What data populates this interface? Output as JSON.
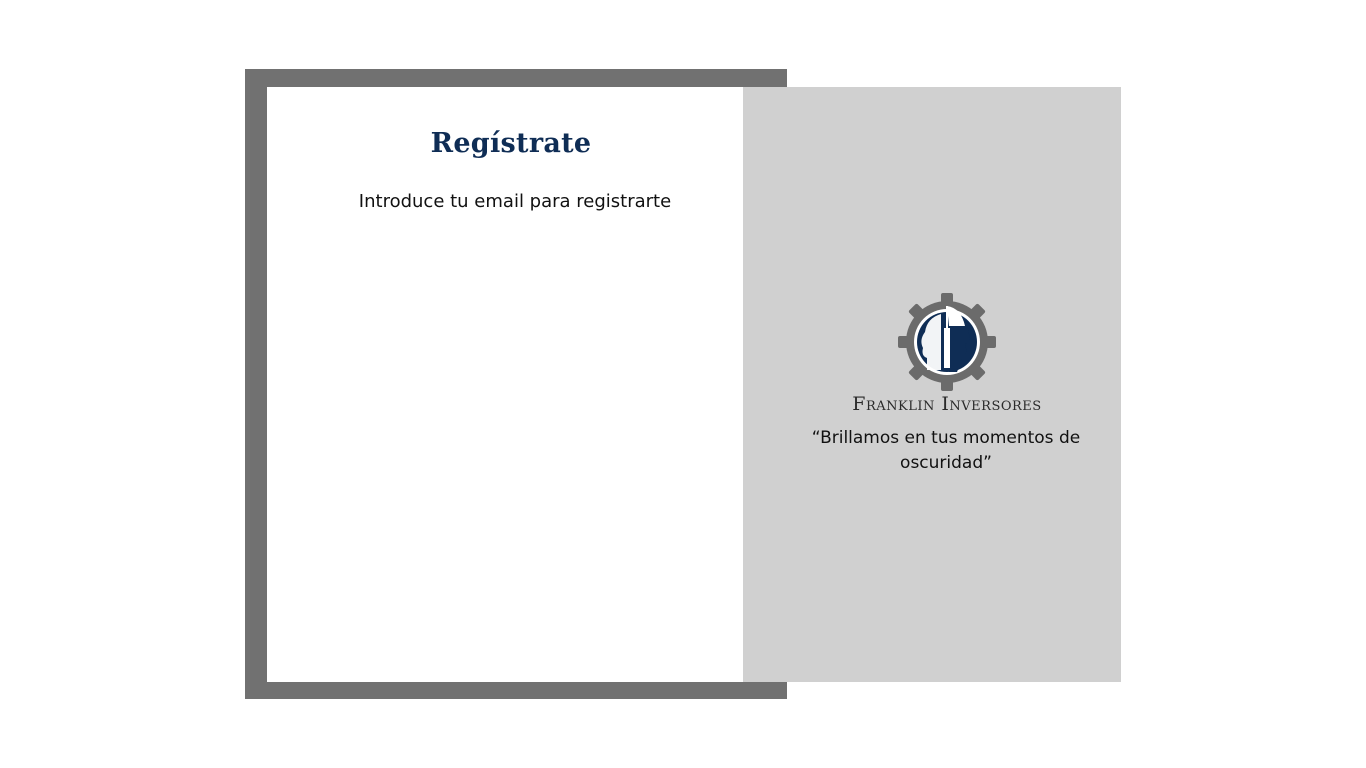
{
  "form": {
    "title": "Regístrate",
    "subtitle": "Introduce tu email para registrarte"
  },
  "brand": {
    "name": "Franklin Inversores",
    "slogan": "“Brillamos en tus momentos de oscuridad”",
    "logo_icon": "gear-head-helmet-icon"
  },
  "colors": {
    "frame": "#717171",
    "brand_panel": "#d0d0d0",
    "title": "#0f2d55",
    "logo_gear": "#6b6b6b",
    "logo_head": "#0f2d55"
  }
}
